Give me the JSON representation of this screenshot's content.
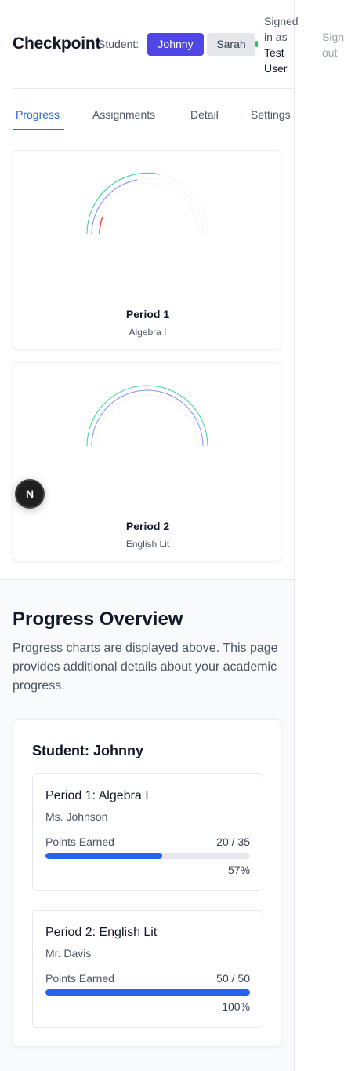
{
  "header": {
    "brand": "Checkpoint",
    "student_label": "Student:",
    "students": [
      "Johnny",
      "Sarah"
    ],
    "active_student": "Johnny",
    "signed_in_prefix_1": "Signed",
    "signed_in_prefix_2": "in as",
    "user_first": "Test",
    "user_last": "User",
    "signout_1": "Sign",
    "signout_2": "out"
  },
  "tabs": [
    "Progress",
    "Assignments",
    "Detail",
    "Settings"
  ],
  "active_tab": "Progress",
  "periods": [
    {
      "title": "Period 1",
      "subject": "Algebra I",
      "progress": 0.57
    },
    {
      "title": "Period 2",
      "subject": "English Lit",
      "progress": 1.0
    }
  ],
  "dev_badge": "N",
  "overview": {
    "title": "Progress Overview",
    "description": "Progress charts are displayed above. This page provides additional details about your academic progress.",
    "student_heading": "Student: Johnny",
    "courses": [
      {
        "name": "Period 1: Algebra I",
        "teacher": "Ms. Johnson",
        "points_label": "Points Earned",
        "points": "20 / 35",
        "percent": "57%",
        "progress": 0.57
      },
      {
        "name": "Period 2: English Lit",
        "teacher": "Mr. Davis",
        "points_label": "Points Earned",
        "points": "50 / 50",
        "percent": "100%",
        "progress": 1.0
      }
    ]
  },
  "colors": {
    "accent": "#4f46e5",
    "link": "#2563eb",
    "gauge_green": "#34d399",
    "gauge_blue": "#818cf8",
    "gauge_red": "#ef4444",
    "status_green": "#22c55e"
  }
}
